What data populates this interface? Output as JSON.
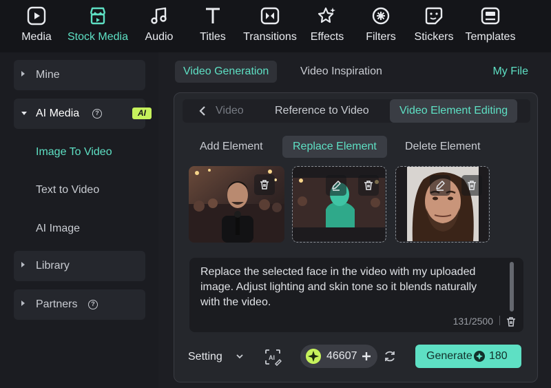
{
  "toolbar": {
    "items": [
      {
        "label": "Media",
        "icon": "media-icon"
      },
      {
        "label": "Stock Media",
        "icon": "stock-media-icon",
        "active": true
      },
      {
        "label": "Audio",
        "icon": "music-note-icon"
      },
      {
        "label": "Titles",
        "icon": "text-t-icon"
      },
      {
        "label": "Transitions",
        "icon": "transition-icon"
      },
      {
        "label": "Effects",
        "icon": "effects-star-icon"
      },
      {
        "label": "Filters",
        "icon": "filter-icon"
      },
      {
        "label": "Stickers",
        "icon": "sticker-icon"
      },
      {
        "label": "Templates",
        "icon": "template-icon"
      }
    ]
  },
  "sidebar": {
    "mine": "Mine",
    "ai_media": "AI Media",
    "ai_badge": "AI",
    "ai_children": [
      "Image To Video",
      "Text to Video",
      "AI Image"
    ],
    "library": "Library",
    "partners": "Partners"
  },
  "main": {
    "tabs": [
      "Video Generation",
      "Video Inspiration"
    ],
    "my_file": "My File",
    "sub_tabs": [
      "Video",
      "Reference to Video",
      "Video Element Editing"
    ],
    "operations": [
      "Add Element",
      "Replace Element",
      "Delete Element"
    ],
    "prompt_text": "Replace the selected face in the video with my uploaded image. Adjust lighting and skin tone so it blends naturally with the video.",
    "char_count": "131/2500",
    "setting_label": "Setting",
    "credits": "46607",
    "generate_label": "Generate",
    "generate_cost": "180"
  },
  "colors": {
    "accent": "#5ee0c4",
    "badge": "#c6f25c",
    "background": "#141519"
  }
}
